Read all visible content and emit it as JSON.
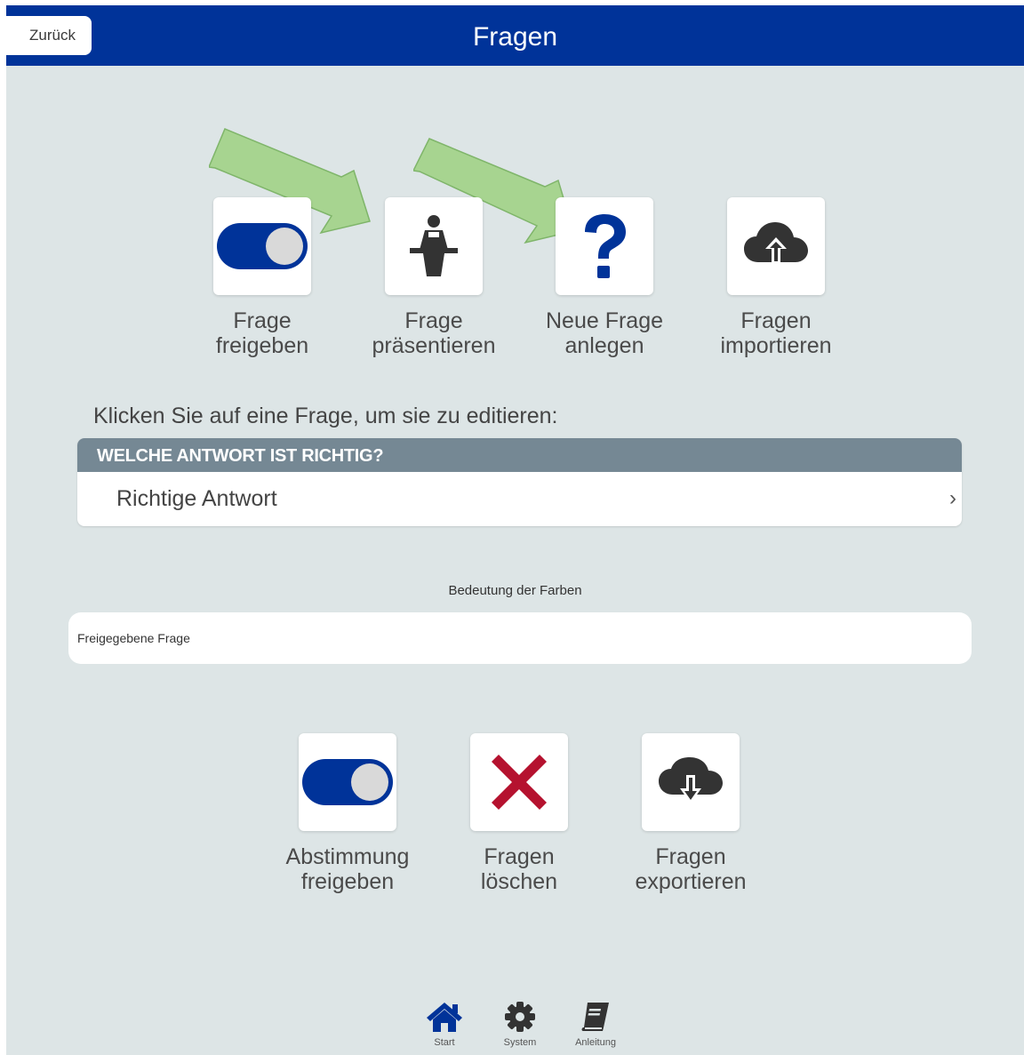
{
  "header": {
    "back_label": "Zurück",
    "title": "Fragen"
  },
  "top_actions": [
    {
      "icon": "toggle-on-icon",
      "label_line1": "Frage",
      "label_line2": "freigeben"
    },
    {
      "icon": "presenter-icon",
      "label_line1": "Frage",
      "label_line2": "präsentieren"
    },
    {
      "icon": "question-mark-icon",
      "label_line1": "Neue Frage",
      "label_line2": "anlegen"
    },
    {
      "icon": "cloud-upload-icon",
      "label_line1": "Fragen",
      "label_line2": "importieren"
    }
  ],
  "instruction": "Klicken Sie auf eine Frage, um sie zu editieren:",
  "question_group": {
    "header": "WELCHE ANTWORT IST RICHTIG?",
    "items": [
      {
        "label": "Richtige Antwort",
        "chevron": "›"
      }
    ]
  },
  "legend": {
    "title": "Bedeutung der Farben",
    "items": [
      "Freigegebene Frage"
    ]
  },
  "bottom_actions": [
    {
      "icon": "toggle-on-icon",
      "label_line1": "Abstimmung",
      "label_line2": "freigeben"
    },
    {
      "icon": "delete-x-icon",
      "label_line1": "Fragen",
      "label_line2": "löschen"
    },
    {
      "icon": "cloud-download-icon",
      "label_line1": "Fragen",
      "label_line2": "exportieren"
    }
  ],
  "nav": [
    {
      "icon": "home-icon",
      "label": "Start"
    },
    {
      "icon": "gear-icon",
      "label": "System"
    },
    {
      "icon": "book-icon",
      "label": "Anleitung"
    }
  ],
  "colors": {
    "header_bg": "#003399",
    "page_bg": "#dde5e6",
    "icon_blue": "#003399",
    "delete_red": "#b5122f",
    "group_header_bg": "#758894",
    "arrow_green": "#9ccf84"
  }
}
